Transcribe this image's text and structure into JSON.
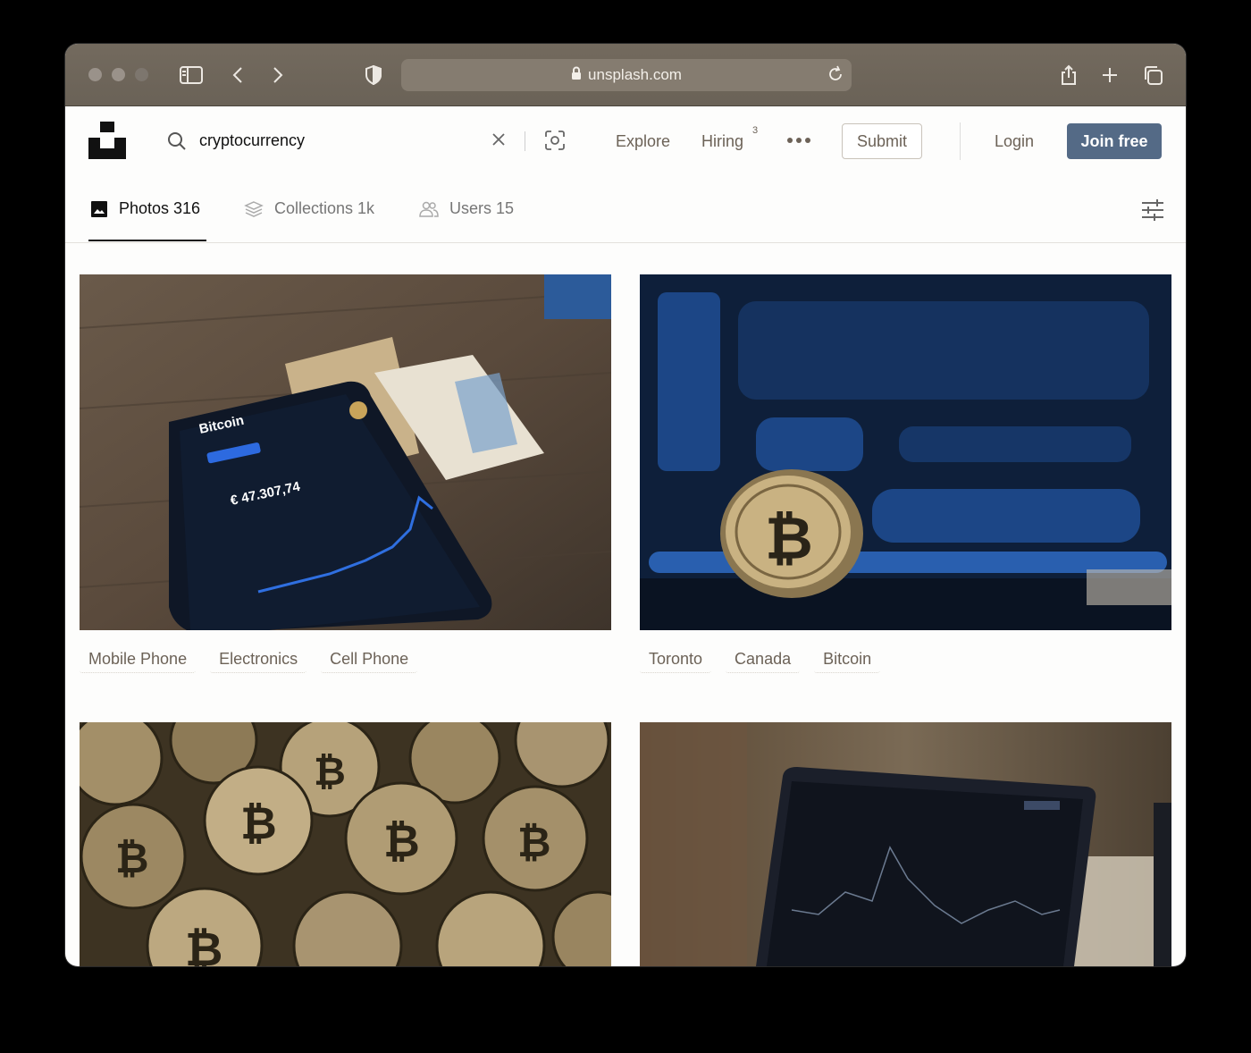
{
  "browser": {
    "url": "unsplash.com"
  },
  "header": {
    "search_value": "cryptocurrency",
    "nav": {
      "explore": "Explore",
      "hiring": "Hiring",
      "hiring_badge": "3"
    },
    "submit_label": "Submit",
    "login_label": "Login",
    "join_label": "Join free"
  },
  "tabs": [
    {
      "label": "Photos 316",
      "icon": "image-icon",
      "active": true
    },
    {
      "label": "Collections 1k",
      "icon": "collections-icon",
      "active": false
    },
    {
      "label": "Users 15",
      "icon": "users-icon",
      "active": false
    }
  ],
  "results": [
    {
      "subject": "smartphone showing Bitcoin price chart next to a 5 euro note",
      "tags": [
        "Mobile Phone",
        "Electronics",
        "Cell Phone"
      ]
    },
    {
      "subject": "gold bitcoin coin in front of blurred blue market screens",
      "tags": [
        "Toronto",
        "Canada",
        "Bitcoin"
      ]
    },
    {
      "subject": "pile of gold bitcoin coins",
      "tags": []
    },
    {
      "subject": "person looking at trading chart on a laptop",
      "tags": []
    }
  ],
  "colors": {
    "accent": "#546a86",
    "tag_text": "#6c6257",
    "chrome": "#6f665a"
  }
}
